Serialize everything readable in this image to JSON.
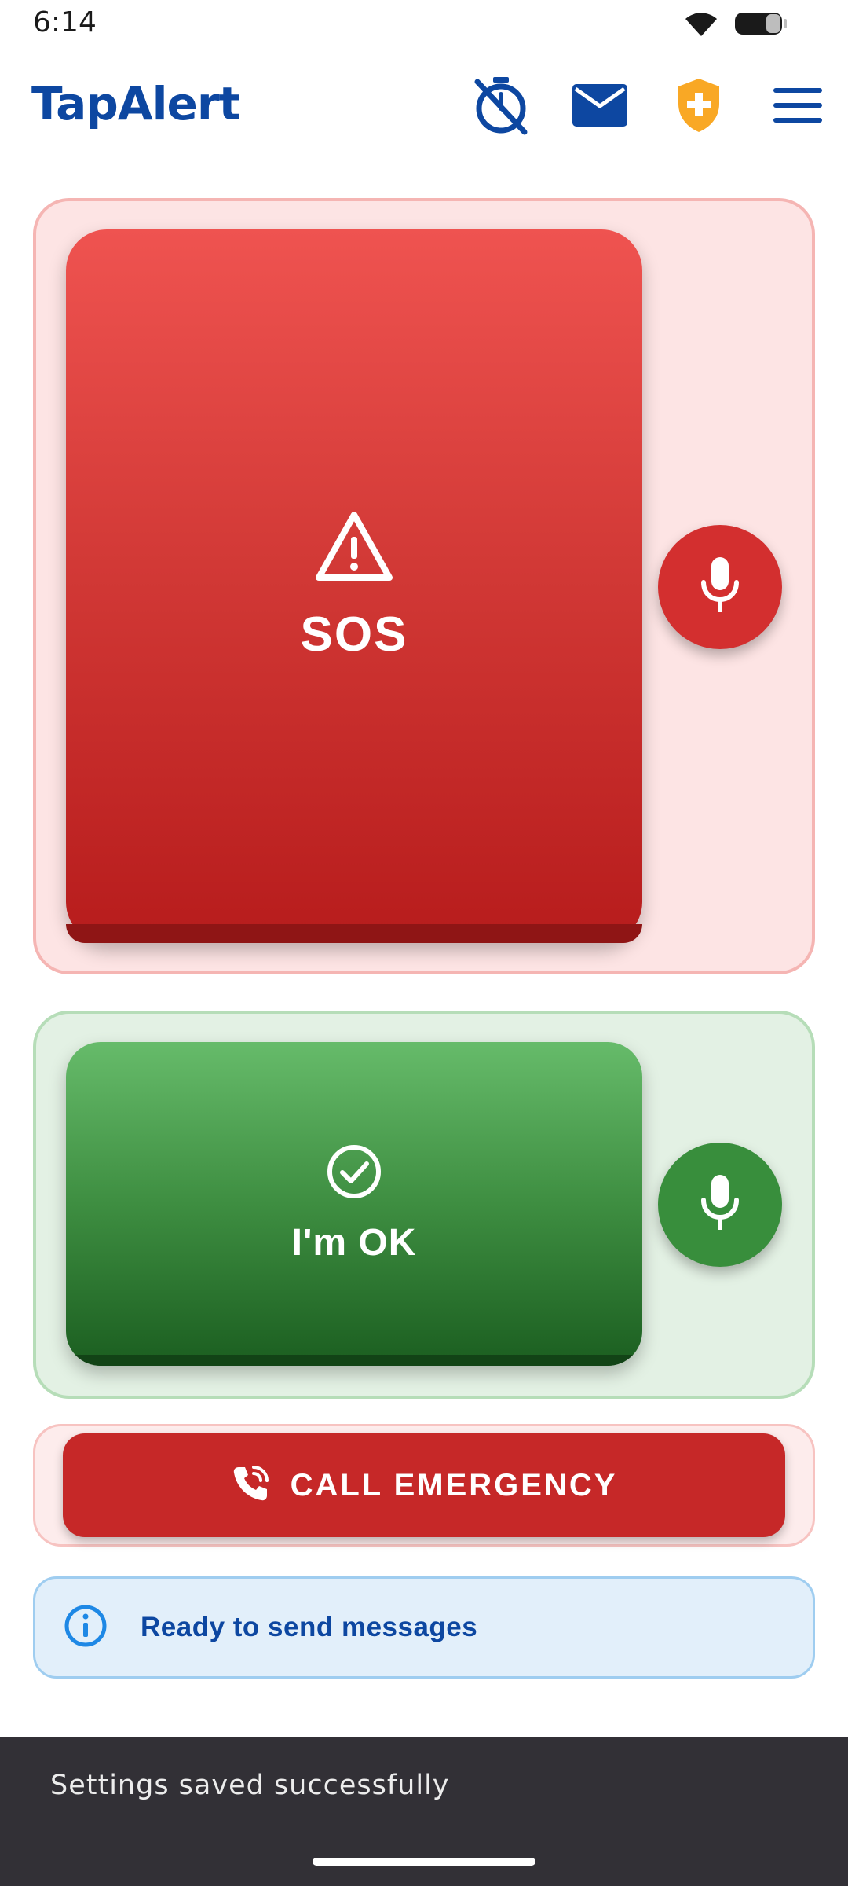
{
  "status_bar": {
    "time": "6:14",
    "icons": [
      "wifi-icon",
      "battery-icon"
    ]
  },
  "app_bar": {
    "title": "TapAlert",
    "actions": [
      "timer-off-icon",
      "mail-icon",
      "shield-plus-icon",
      "menu-icon"
    ],
    "colors": {
      "primary": "#0d47a1",
      "shield": "#f9a825"
    }
  },
  "sos": {
    "label": "SOS",
    "icon": "warning-triangle-icon",
    "mic_icon": "microphone-icon",
    "colors": {
      "button": "#d32f2f",
      "card": "#fde4e4"
    }
  },
  "ok": {
    "label": "I'm OK",
    "icon": "check-circle-icon",
    "mic_icon": "microphone-icon",
    "colors": {
      "button": "#388e3c",
      "card": "#e3f1e4"
    }
  },
  "call": {
    "label": "CALL EMERGENCY",
    "icon": "phone-call-icon",
    "colors": {
      "button": "#c62828"
    }
  },
  "status_message": {
    "text": "Ready to send messages",
    "icon": "info-icon",
    "colors": {
      "text": "#0d47a1",
      "background": "#e2effa"
    }
  },
  "snackbar": {
    "text": "Settings saved successfully"
  }
}
